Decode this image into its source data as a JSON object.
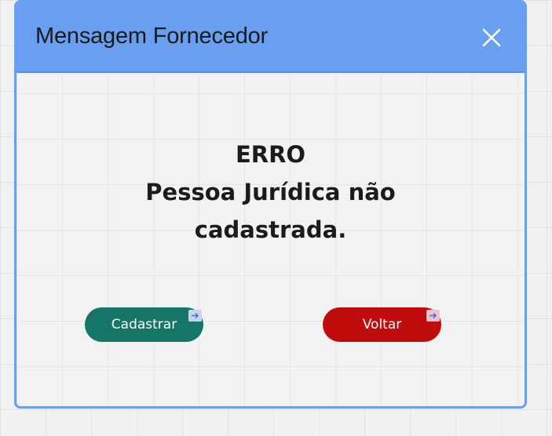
{
  "dialog": {
    "title": "Mensagem Fornecedor",
    "close_icon": "close-icon",
    "message": {
      "line1": "ERRO",
      "line2": "Pessoa Jurídica não cadastrada."
    },
    "buttons": {
      "cadastrar": "Cadastrar",
      "voltar": "Voltar"
    },
    "colors": {
      "header": "#699ff0",
      "border": "#6a9ef0",
      "cadastrar_bg": "#157567",
      "voltar_bg": "#c00c0c"
    },
    "badge_icon": "arrow-right-icon"
  }
}
